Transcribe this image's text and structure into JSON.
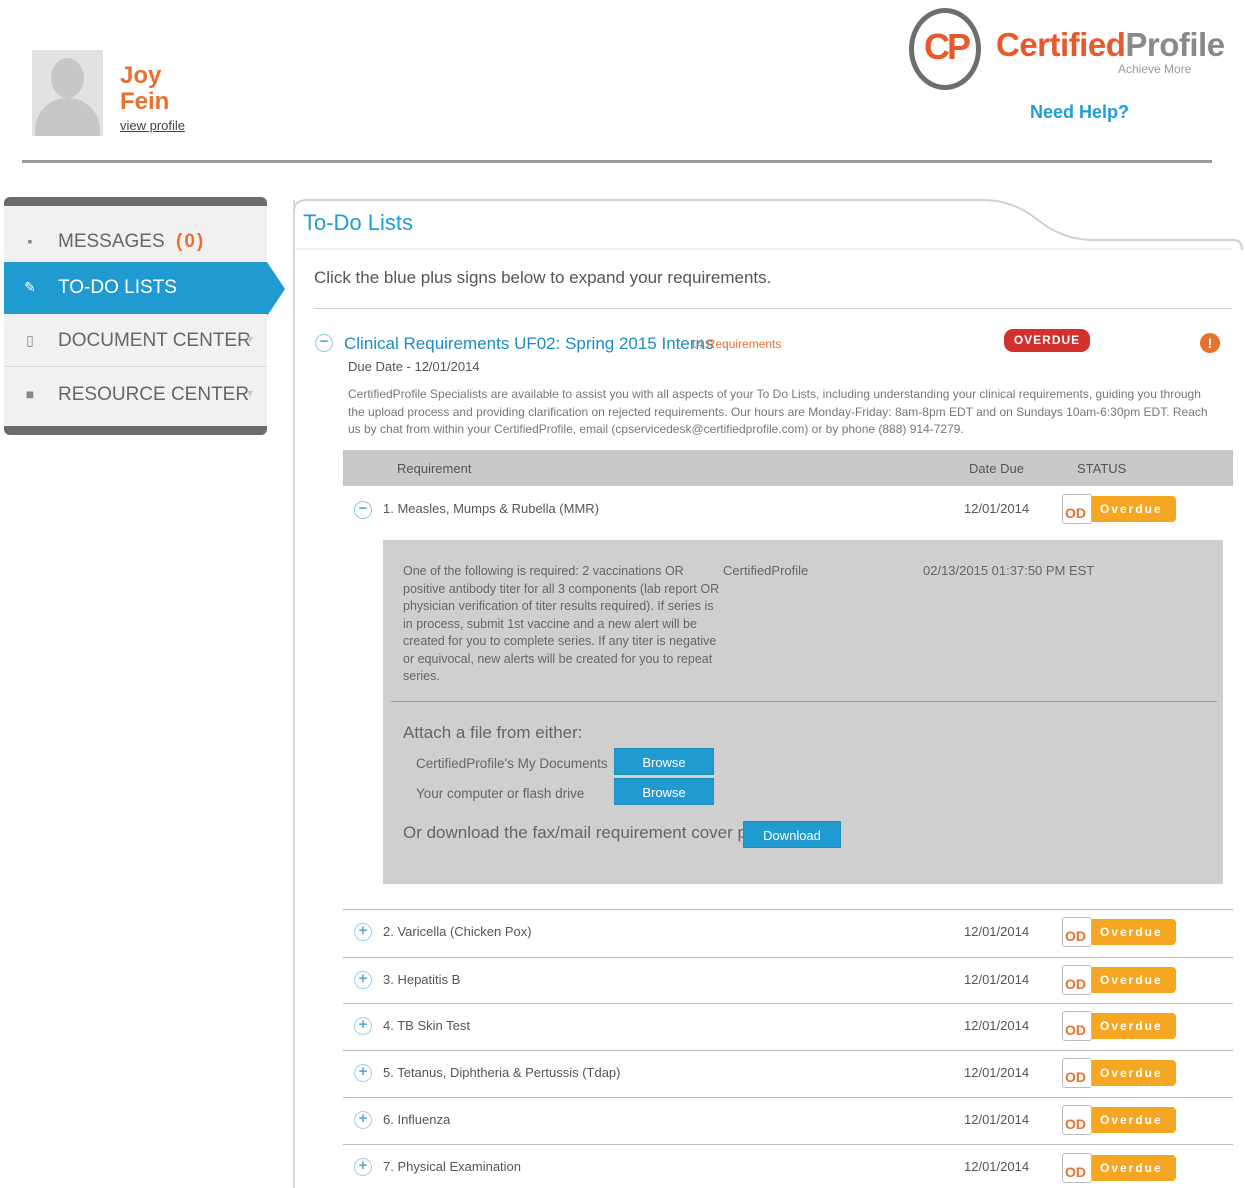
{
  "user": {
    "first_name": "Joy",
    "last_name": "Fein",
    "view_profile": "view profile"
  },
  "brand": {
    "logo_mark": "CP",
    "name_a": "Certified",
    "name_b": "Profile",
    "tagline": "Achieve More",
    "help": "Need Help?",
    "colors": {
      "accent": "#1f9bd1",
      "brand_orange": "#e8582a",
      "overdue_red": "#d2312e",
      "overdue_orange": "#f5a623"
    }
  },
  "sidebar": {
    "items": [
      {
        "label": "MESSAGES",
        "count": "(0)",
        "icon": "envelope-icon"
      },
      {
        "label": "TO-DO LISTS",
        "icon": "edit-icon",
        "active": true
      },
      {
        "label": "DOCUMENT CENTER",
        "icon": "document-icon"
      },
      {
        "label": "RESOURCE CENTER",
        "icon": "briefcase-icon"
      }
    ]
  },
  "main": {
    "title": "To-Do Lists",
    "instructions": "Click the blue plus signs below to expand your requirements.",
    "list": {
      "title": "Clinical Requirements UF02: Spring 2015 Interns",
      "count": "14 Requirements",
      "badge": "OVERDUE",
      "alert": "!",
      "due": "Due Date - 12/01/2014",
      "description": "CertifiedProfile Specialists are available to assist you with all aspects of your To Do Lists, including understanding your clinical requirements, guiding you through the upload process and providing clarification on rejected requirements. Our hours are Monday-Friday: 8am-8pm EDT and on Sundays 10am-6:30pm EDT. Reach us by chat from within your CertifiedProfile, email (cpservicedesk@certifiedprofile.com) or by phone (888) 914-7279."
    },
    "table": {
      "headers": {
        "requirement": "Requirement",
        "date": "Date Due",
        "status": "STATUS"
      },
      "status_od": "OD",
      "status_label": "Overdue",
      "rows": [
        {
          "name": "1. Measles, Mumps & Rubella (MMR)",
          "date": "12/01/2014"
        },
        {
          "name": "2. Varicella (Chicken Pox)",
          "date": "12/01/2014"
        },
        {
          "name": "3. Hepatitis B",
          "date": "12/01/2014"
        },
        {
          "name": "4. TB Skin Test",
          "date": "12/01/2014"
        },
        {
          "name": "5. Tetanus, Diphtheria & Pertussis (Tdap)",
          "date": "12/01/2014"
        },
        {
          "name": "6. Influenza",
          "date": "12/01/2014"
        },
        {
          "name": "7. Physical Examination",
          "date": "12/01/2014"
        }
      ]
    },
    "detail": {
      "text": "One of the following is required: 2 vaccinations OR positive antibody titer for all 3 components (lab report OR physician verification of titer results required). If series is in process, submit 1st vaccine and a new alert will be created for you to complete series. If any titer is negative or equivocal, new alerts will be created for you to repeat series.",
      "source": "CertifiedProfile",
      "timestamp": "02/13/2015 01:37:50 PM EST",
      "attach_title": "Attach a file from either:",
      "option1": "CertifiedProfile's My Documents",
      "option2": "Your computer or flash drive",
      "browse": "Browse",
      "download_text": "Or download the fax/mail requirement cover page",
      "download": "Download"
    }
  }
}
